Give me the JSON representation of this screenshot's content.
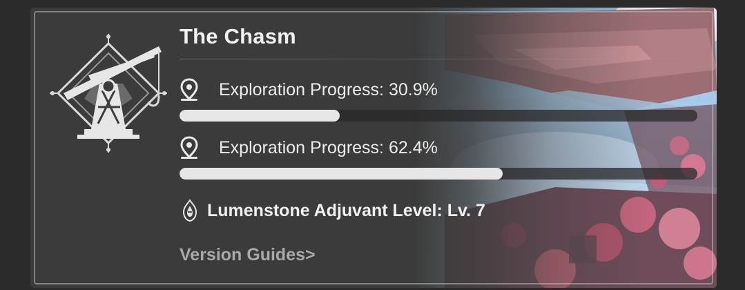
{
  "area": {
    "title": "The Chasm",
    "emblem_icon": "crane-emblem-icon"
  },
  "progress": [
    {
      "icon": "map-pin-icon",
      "label": "Exploration Progress: 30.9%",
      "value": 0.309
    },
    {
      "icon": "map-pin-icon",
      "label": "Exploration Progress: 62.4%",
      "value": 0.624
    }
  ],
  "lumenstone": {
    "icon": "lumenstone-icon",
    "label": "Lumenstone Adjuvant Level: Lv. 7"
  },
  "links": {
    "version_guides": "Version Guides>"
  },
  "colors": {
    "background": "#2b2b2b",
    "card": "#3b3b3b",
    "bar_fill": "#e6e6e6",
    "bar_track": "#282828",
    "link": "#a9a9a9"
  }
}
